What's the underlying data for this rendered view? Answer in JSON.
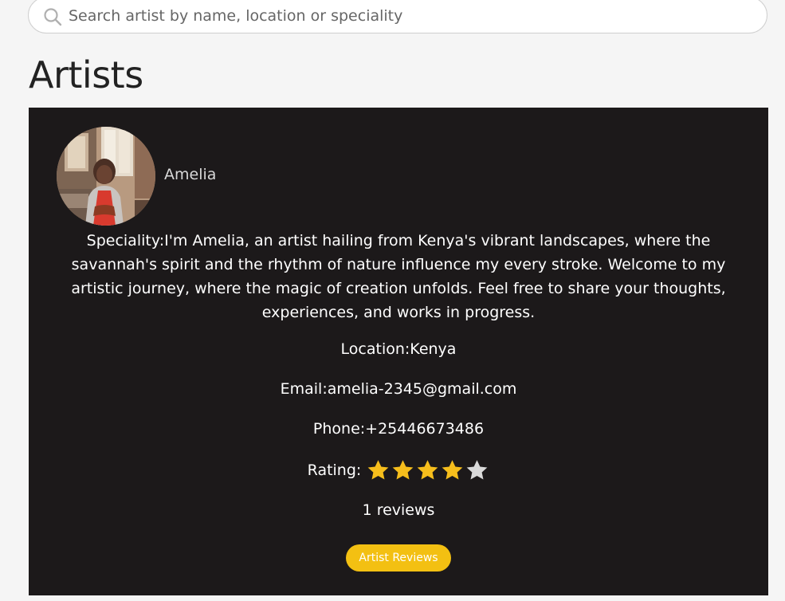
{
  "search": {
    "placeholder": "Search artist by name, location or speciality",
    "value": ""
  },
  "page_title": "Artists",
  "artist": {
    "name": "Amelia",
    "speciality": "Speciality:I'm Amelia, an artist hailing from Kenya's vibrant landscapes, where the savannah's spirit and the rhythm of nature influence my every stroke. Welcome to my artistic journey, where the magic of creation unfolds. Feel free to share your thoughts, experiences, and works in progress.",
    "location": "Location:Kenya",
    "email": "Email:amelia-2345@gmail.com",
    "phone": "Phone:+25446673486",
    "rating_label": "Rating:",
    "rating": 4,
    "rating_max": 5,
    "reviews": "1 reviews",
    "reviews_button": "Artist Reviews"
  },
  "colors": {
    "card_background": "#1c191a",
    "star_filled": "#f6be1c",
    "star_empty": "#d9d9d9",
    "button": "#f3c012"
  },
  "icons": {
    "search": "search-icon",
    "star": "star-icon"
  }
}
